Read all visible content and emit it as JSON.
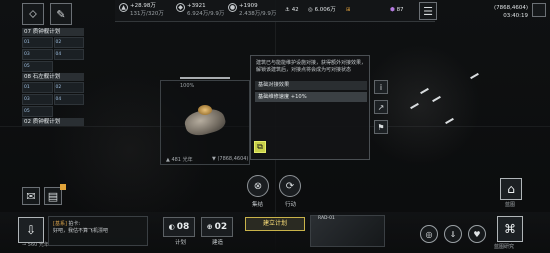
{
  "top": {
    "resources": [
      {
        "amount": "+28.98万",
        "sub": "131万/320万",
        "icon": "metal-icon"
      },
      {
        "amount": "+3921",
        "sub": "6.924万/9.9万",
        "icon": "crystal-icon"
      },
      {
        "amount": "+1909",
        "sub": "2.438万/9.9万",
        "icon": "deuterium-icon"
      }
    ],
    "ships_count": "42",
    "currency": "6.006万",
    "gems": "87",
    "coords": "(7868,4604)",
    "time": "03:40:19"
  },
  "fleets": [
    {
      "header": "07 质钟舰计划",
      "ships": [
        "01",
        "02",
        "03",
        "04",
        "05"
      ]
    },
    {
      "header": "08 石左舰计划",
      "ships": [
        "01",
        "02",
        "03",
        "04",
        "05"
      ]
    },
    {
      "header": "02 质钟舰计划",
      "ships": []
    }
  ],
  "structure": {
    "hp_percent": "100%",
    "distance": "481 光年",
    "coord": "(7868,4604)"
  },
  "popup": {
    "description": "建筑已与能能维护设施对接，获得额外对接效果，解锁该建筑后，对接点将会成为可对接状态",
    "effect_header": "基础对接效果",
    "effect_row": "基础维修速度 +10%"
  },
  "actions": [
    {
      "label": "集结",
      "icon": "gather-icon"
    },
    {
      "label": "行动",
      "icon": "move-icon"
    }
  ],
  "bottom": {
    "plan_count": "08",
    "plan_label": "计划",
    "build_count": "02",
    "build_label": "建造",
    "build_plan_button": "建立计划",
    "chat_tag": "[基系]",
    "chat_name": "拍卡:",
    "chat_text": "好吧，我估不算飞机漂吧",
    "distance": "560 光年",
    "thumb_title": "RAD-01",
    "blueprint_label": "蓝图",
    "research_label": "蓝图研究"
  }
}
